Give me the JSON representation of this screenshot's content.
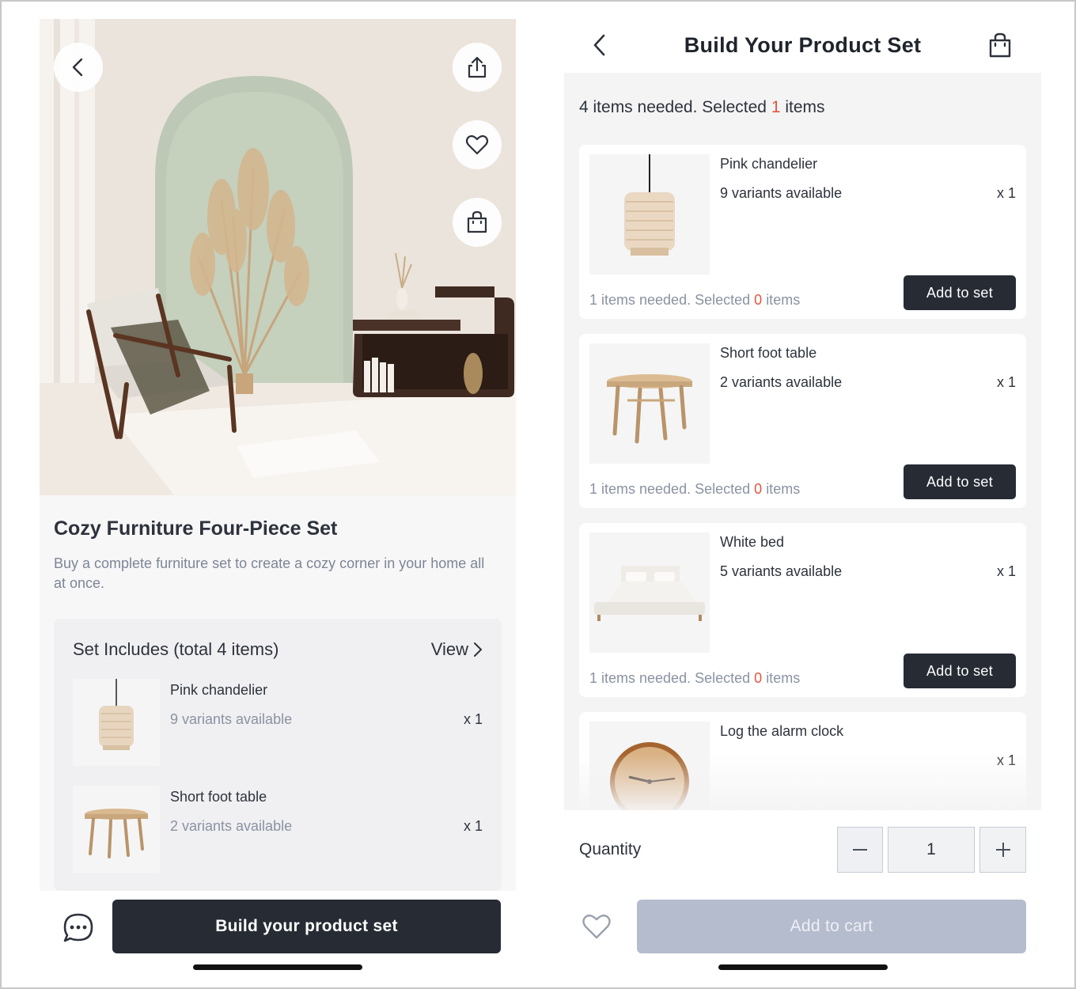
{
  "left": {
    "set_title": "Cozy Furniture Four-Piece Set",
    "set_description": "Buy a complete furniture set to create a cozy corner in your home all at once.",
    "includes_heading": "Set Includes (total 4 items)",
    "includes_view_label": "View",
    "includes_items": [
      {
        "name": "Pink chandelier",
        "variants": "9 variants available",
        "qty": "x 1"
      },
      {
        "name": "Short foot table",
        "variants": "2 variants available",
        "qty": "x 1"
      }
    ],
    "primary_button": "Build your product set"
  },
  "right": {
    "title": "Build Your Product Set",
    "summary_prefix": "4 items needed. Selected",
    "summary_count": "1",
    "summary_suffix": "items",
    "items": [
      {
        "name": "Pink chandelier",
        "variants": "9 variants available",
        "qty": "x 1",
        "need_prefix": "1 items needed. Selected",
        "need_count": "0",
        "need_suffix": "items",
        "button": "Add to set"
      },
      {
        "name": "Short foot table",
        "variants": "2 variants available",
        "qty": "x 1",
        "need_prefix": "1 items needed. Selected",
        "need_count": "0",
        "need_suffix": "items",
        "button": "Add to set"
      },
      {
        "name": "White bed",
        "variants": "5 variants available",
        "qty": "x 1",
        "need_prefix": "1 items needed. Selected",
        "need_count": "0",
        "need_suffix": "items",
        "button": "Add to set"
      },
      {
        "name": "Log the alarm clock",
        "qty": "x 1"
      }
    ],
    "quantity_label": "Quantity",
    "quantity_value": "1",
    "cart_button": "Add to cart"
  },
  "colors": {
    "primary": "#262b34",
    "accent_red": "#e3553d",
    "disabled": "#b5bccd",
    "muted_text": "#8a92a2"
  },
  "icons": [
    "back-arrow-icon",
    "share-icon",
    "heart-icon",
    "shopping-bag-icon",
    "chat-bubble-icon",
    "chevron-right-icon",
    "minus-icon",
    "plus-icon"
  ]
}
